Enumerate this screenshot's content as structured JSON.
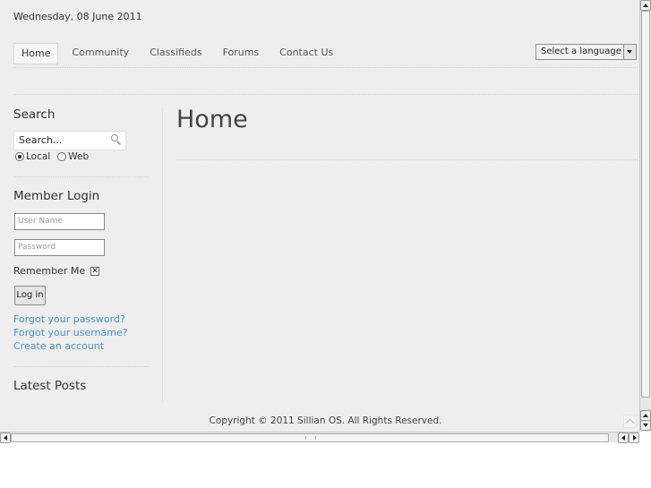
{
  "header": {
    "date": "Wednesday, 08 June 2011"
  },
  "nav": {
    "items": [
      "Home",
      "Community",
      "Classifieds",
      "Forums",
      "Contact Us"
    ],
    "active": "Home"
  },
  "language_select": {
    "value": "Select a language"
  },
  "search": {
    "heading": "Search",
    "input_value": "Search...",
    "options": [
      {
        "label": "Local",
        "checked": true
      },
      {
        "label": "Web",
        "checked": false
      }
    ]
  },
  "login": {
    "heading": "Member Login",
    "username_placeholder": "User Name",
    "password_placeholder": "Password",
    "remember_label": "Remember Me",
    "button_label": "Log in",
    "links": [
      "Forgot your password?",
      "Forgot your username?",
      "Create an account"
    ]
  },
  "latest_posts": {
    "heading": "Latest Posts"
  },
  "main": {
    "heading": "Home"
  },
  "footer": {
    "copyright": "Copyright © 2011 Sillian OS. All Rights Reserved."
  },
  "colors": {
    "background": "#eeeeee",
    "link": "#4a90c9"
  }
}
